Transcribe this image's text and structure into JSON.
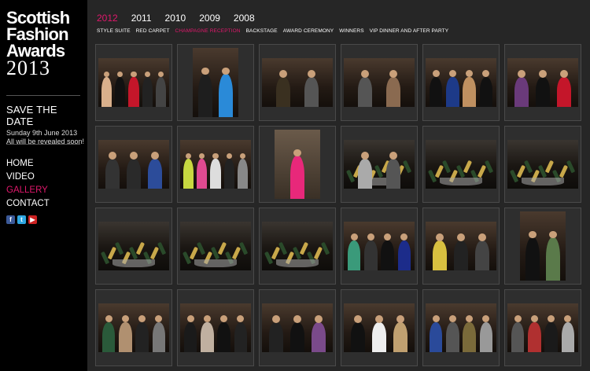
{
  "logo": {
    "line1": "Scottish",
    "line2": "Fashion",
    "line3": "Awards",
    "year": "2013"
  },
  "save_the_date": {
    "title": "SAVE THE DATE",
    "date": "Sunday 9th June 2013",
    "reveal": "All will be revealed soon!"
  },
  "nav": [
    {
      "label": "HOME",
      "active": false
    },
    {
      "label": "VIDEO",
      "active": false
    },
    {
      "label": "GALLERY",
      "active": true
    },
    {
      "label": "CONTACT",
      "active": false
    }
  ],
  "social": [
    {
      "name": "facebook",
      "glyph": "f",
      "icon": "facebook-icon"
    },
    {
      "name": "twitter",
      "glyph": "t",
      "icon": "twitter-icon"
    },
    {
      "name": "youtube",
      "glyph": "▶",
      "icon": "youtube-icon"
    }
  ],
  "years": [
    {
      "label": "2012",
      "active": true
    },
    {
      "label": "2011",
      "active": false
    },
    {
      "label": "2010",
      "active": false
    },
    {
      "label": "2009",
      "active": false
    },
    {
      "label": "2008",
      "active": false
    }
  ],
  "categories": [
    {
      "label": "STYLE SUITE",
      "active": false
    },
    {
      "label": "RED CARPET",
      "active": false
    },
    {
      "label": "CHAMPAGNE RECEPTION",
      "active": true
    },
    {
      "label": "BACKSTAGE",
      "active": false
    },
    {
      "label": "AWARD CEREMONY",
      "active": false
    },
    {
      "label": "WINNERS",
      "active": false
    },
    {
      "label": "VIP DINNER AND AFTER PARTY",
      "active": false
    }
  ],
  "colors": {
    "accent": "#e0186c",
    "sidebar": "#000000",
    "content_bg": "#262626",
    "tile_border": "#4a4a4a"
  },
  "gallery": [
    {
      "orient": "landscape",
      "scene": "group",
      "people": 5,
      "colors": [
        "#d9b08c",
        "#111111",
        "#c4162a",
        "#222222",
        "#444444"
      ]
    },
    {
      "orient": "portrait",
      "scene": "group",
      "people": 2,
      "colors": [
        "#1e1e1e",
        "#2a8ad8"
      ]
    },
    {
      "orient": "landscape",
      "scene": "group",
      "people": 2,
      "colors": [
        "#3a3020",
        "#555555"
      ]
    },
    {
      "orient": "landscape",
      "scene": "group",
      "people": 2,
      "colors": [
        "#555555",
        "#8a6a50"
      ]
    },
    {
      "orient": "landscape",
      "scene": "group",
      "people": 4,
      "colors": [
        "#111111",
        "#1d3a88",
        "#c09060",
        "#111111"
      ]
    },
    {
      "orient": "landscape",
      "scene": "group",
      "people": 3,
      "colors": [
        "#6a3a7a",
        "#111111",
        "#c4162a"
      ]
    },
    {
      "orient": "landscape",
      "scene": "group",
      "people": 3,
      "colors": [
        "#333333",
        "#2a2a2a",
        "#2c4c9a"
      ]
    },
    {
      "orient": "landscape",
      "scene": "group",
      "people": 5,
      "colors": [
        "#c8d840",
        "#e04a90",
        "#dddddd",
        "#222222",
        "#888888"
      ]
    },
    {
      "orient": "portrait",
      "scene": "single",
      "people": 1,
      "colors": [
        "#e8287a"
      ]
    },
    {
      "orient": "landscape",
      "scene": "bottles",
      "people": 2,
      "colors": [
        "#aaaaaa",
        "#555555"
      ]
    },
    {
      "orient": "landscape",
      "scene": "bottles",
      "people": 0,
      "colors": []
    },
    {
      "orient": "landscape",
      "scene": "bottles",
      "people": 0,
      "colors": []
    },
    {
      "orient": "landscape",
      "scene": "bottles",
      "people": 0,
      "colors": []
    },
    {
      "orient": "landscape",
      "scene": "bottles",
      "people": 0,
      "colors": []
    },
    {
      "orient": "landscape",
      "scene": "bottles",
      "people": 0,
      "colors": []
    },
    {
      "orient": "landscape",
      "scene": "group",
      "people": 4,
      "colors": [
        "#3a9a7a",
        "#333333",
        "#111111",
        "#1c2c8a"
      ]
    },
    {
      "orient": "landscape",
      "scene": "group",
      "people": 3,
      "colors": [
        "#d8c040",
        "#222222",
        "#444444"
      ]
    },
    {
      "orient": "portrait",
      "scene": "group",
      "people": 2,
      "colors": [
        "#111111",
        "#5a7a4a"
      ]
    },
    {
      "orient": "landscape",
      "scene": "group",
      "people": 4,
      "colors": [
        "#2a5a3a",
        "#b09070",
        "#222222",
        "#777777"
      ]
    },
    {
      "orient": "landscape",
      "scene": "group",
      "people": 4,
      "colors": [
        "#1a1a1a",
        "#c0b0a0",
        "#111111",
        "#222222"
      ]
    },
    {
      "orient": "landscape",
      "scene": "group",
      "people": 3,
      "colors": [
        "#222222",
        "#111111",
        "#7a4a8a"
      ]
    },
    {
      "orient": "landscape",
      "scene": "group",
      "people": 3,
      "colors": [
        "#111111",
        "#eeeeee",
        "#c0a070"
      ]
    },
    {
      "orient": "landscape",
      "scene": "group",
      "people": 4,
      "colors": [
        "#2a4a9a",
        "#555555",
        "#7a6a3a",
        "#999999"
      ]
    },
    {
      "orient": "landscape",
      "scene": "group",
      "people": 4,
      "colors": [
        "#555555",
        "#b03030",
        "#1a1a1a",
        "#aaaaaa"
      ]
    }
  ]
}
